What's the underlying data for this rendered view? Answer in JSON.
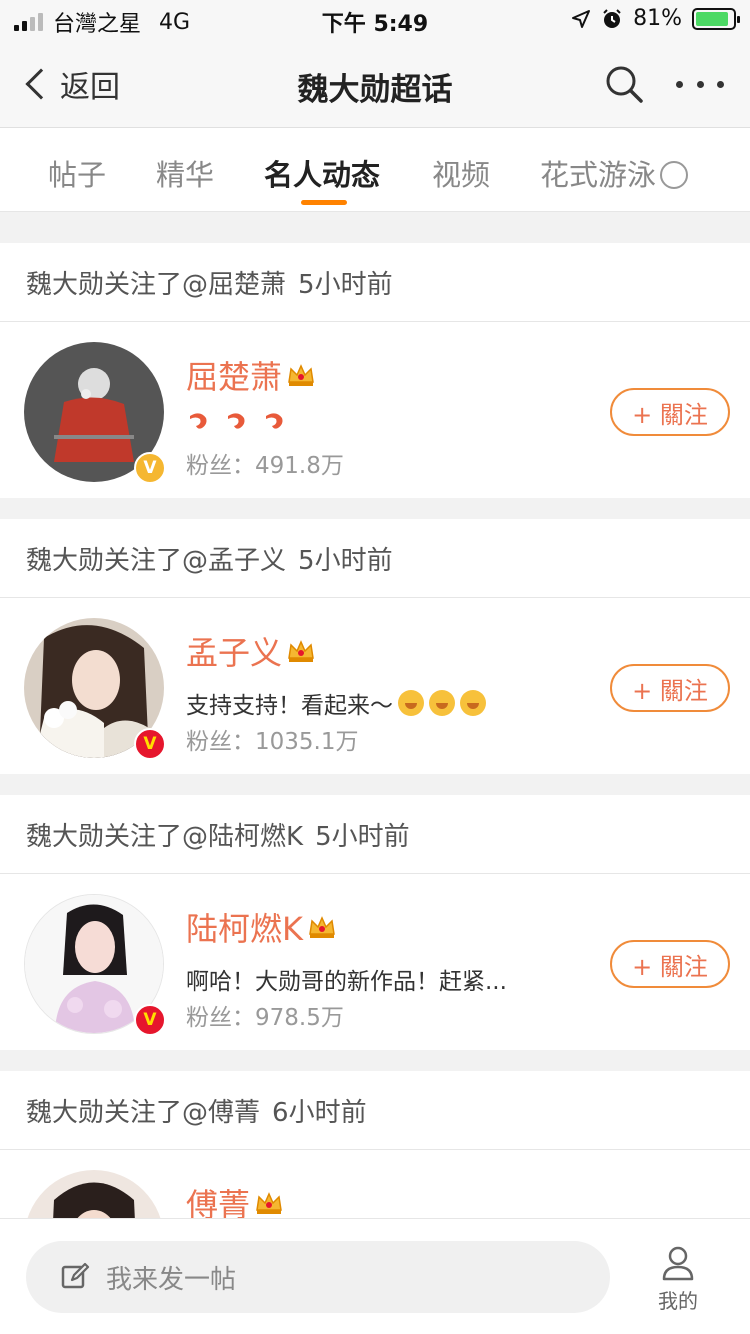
{
  "status_bar": {
    "carrier": "台灣之星",
    "network": "4G",
    "time": "下午 5:49",
    "battery": "81%"
  },
  "nav": {
    "back_label": "返回",
    "title": "魏大勋超话"
  },
  "tabs": [
    {
      "label": "帖子",
      "active": false
    },
    {
      "label": "精华",
      "active": false
    },
    {
      "label": "名人动态",
      "active": true
    },
    {
      "label": "视频",
      "active": false
    },
    {
      "label": "花式游泳",
      "active": false
    }
  ],
  "feed": [
    {
      "header": {
        "prefix": "魏大勋关注了",
        "mention": "@屈楚萧",
        "time": "5小时前"
      },
      "name": "屈楚萧",
      "bio": "",
      "bio_icons": [
        "shrimp-emoji",
        "shrimp-emoji",
        "shrimp-emoji"
      ],
      "fans": "粉丝：491.8万",
      "follow_label": "+ 關注",
      "badge": "V",
      "badge_color": "#f5b731"
    },
    {
      "header": {
        "prefix": "魏大勋关注了",
        "mention": "@孟子义",
        "time": "5小时前"
      },
      "name": "孟子义",
      "bio": "支持支持！看起来～",
      "bio_icons": [
        "blush-emoji",
        "blush-emoji",
        "blush-emoji"
      ],
      "fans": "粉丝：1035.1万",
      "follow_label": "+ 關注",
      "badge": "V",
      "badge_color": "#e6162d"
    },
    {
      "header": {
        "prefix": "魏大勋关注了",
        "mention": "@陆柯燃K",
        "time": "5小时前"
      },
      "name": "陆柯燃K",
      "bio": "啊哈！大勋哥的新作品！赶紧...",
      "bio_icons": [],
      "fans": "粉丝：978.5万",
      "follow_label": "+ 關注",
      "badge": "V",
      "badge_color": "#e6162d"
    },
    {
      "header": {
        "prefix": "魏大勋关注了",
        "mention": "@傅菁",
        "time": "6小时前"
      },
      "name": "傅菁"
    }
  ],
  "bottom_bar": {
    "compose_placeholder": "我来发一帖",
    "me_label": "我的"
  },
  "colors": {
    "accent": "#ff8200",
    "username": "#eb7350",
    "follow_border": "#f08b3a"
  }
}
